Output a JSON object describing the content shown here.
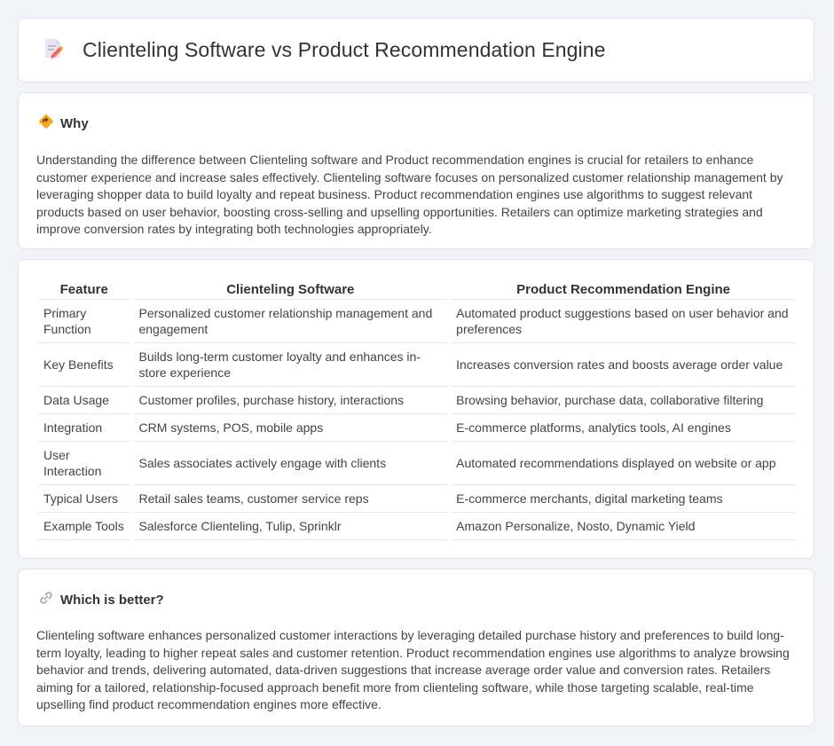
{
  "header": {
    "title": "Clienteling Software vs Product Recommendation Engine"
  },
  "why": {
    "heading": "Why",
    "body": "Understanding the difference between Clienteling software and Product recommendation engines is crucial for retailers to enhance customer experience and increase sales effectively. Clienteling software focuses on personalized customer relationship management by leveraging shopper data to build loyalty and repeat business. Product recommendation engines use algorithms to suggest relevant products based on user behavior, boosting cross-selling and upselling opportunities. Retailers can optimize marketing strategies and improve conversion rates by integrating both technologies appropriately."
  },
  "table": {
    "headers": [
      "Feature",
      "Clienteling Software",
      "Product Recommendation Engine"
    ],
    "rows": [
      [
        "Primary Function",
        "Personalized customer relationship management and engagement",
        "Automated product suggestions based on user behavior and preferences"
      ],
      [
        "Key Benefits",
        "Builds long-term customer loyalty and enhances in-store experience",
        "Increases conversion rates and boosts average order value"
      ],
      [
        "Data Usage",
        "Customer profiles, purchase history, interactions",
        "Browsing behavior, purchase data, collaborative filtering"
      ],
      [
        "Integration",
        "CRM systems, POS, mobile apps",
        "E-commerce platforms, analytics tools, AI engines"
      ],
      [
        "User Interaction",
        "Sales associates actively engage with clients",
        "Automated recommendations displayed on website or app"
      ],
      [
        "Typical Users",
        "Retail sales teams, customer service reps",
        "E-commerce merchants, digital marketing teams"
      ],
      [
        "Example Tools",
        "Salesforce Clienteling, Tulip, Sprinklr",
        "Amazon Personalize, Nosto, Dynamic Yield"
      ]
    ]
  },
  "better": {
    "heading": "Which is better?",
    "body": "Clienteling software enhances personalized customer interactions by leveraging detailed purchase history and preferences to build long-term loyalty, leading to higher repeat sales and customer retention. Product recommendation engines use algorithms to analyze browsing behavior and trends, delivering automated, data-driven suggestions that increase average order value and conversion rates. Retailers aiming for a tailored, relationship-focused approach benefit more from clienteling software, while those targeting scalable, real-time upselling find product recommendation engines more effective."
  },
  "icons": {
    "title": "document-pencil-icon",
    "why": "diamond-direction-icon",
    "better": "link-icon"
  }
}
